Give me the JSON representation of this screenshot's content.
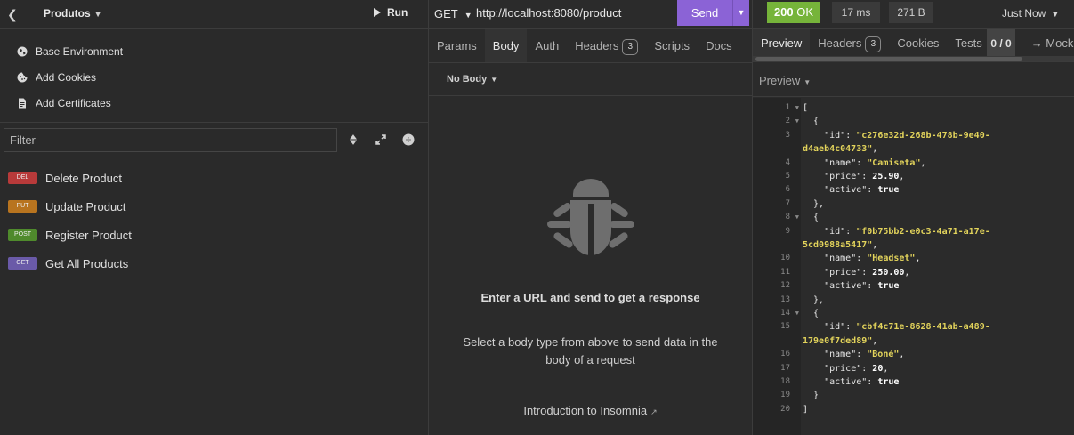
{
  "sidebar": {
    "title": "Produtos",
    "run_label": "Run",
    "links": [
      {
        "label": "Base Environment",
        "icon": "globe-icon"
      },
      {
        "label": "Add Cookies",
        "icon": "cookie-icon"
      },
      {
        "label": "Add Certificates",
        "icon": "certificate-icon"
      }
    ],
    "filter_placeholder": "Filter",
    "requests": [
      {
        "method": "DEL",
        "name": "Delete Product",
        "color": "#b83a3a"
      },
      {
        "method": "PUT",
        "name": "Update Product",
        "color": "#b8741f"
      },
      {
        "method": "POST",
        "name": "Register Product",
        "color": "#4f8a2c"
      },
      {
        "method": "GET",
        "name": "Get All Products",
        "color": "#6a5aa8"
      }
    ]
  },
  "request": {
    "method": "GET",
    "url": "http://localhost:8080/product",
    "send_label": "Send",
    "tabs": [
      {
        "label": "Params"
      },
      {
        "label": "Body"
      },
      {
        "label": "Auth"
      },
      {
        "label": "Headers",
        "count": "3"
      },
      {
        "label": "Scripts"
      },
      {
        "label": "Docs"
      }
    ],
    "active_tab": "Body",
    "body_type": "No Body",
    "empty_title": "Enter a URL and send to get a response",
    "empty_desc": "Select a body type from above to send data in the body of a request",
    "intro_link": "Introduction to Insomnia"
  },
  "response": {
    "status_code": "200",
    "status_text": "OK",
    "time": "17 ms",
    "size": "271 B",
    "when": "Just Now",
    "tabs": [
      {
        "label": "Preview"
      },
      {
        "label": "Headers",
        "count": "3"
      },
      {
        "label": "Cookies"
      },
      {
        "label": "Tests",
        "count": "0 / 0"
      },
      {
        "label": "→ Mock"
      }
    ],
    "preview_mode": "Preview",
    "lines": [
      {
        "n": "1",
        "fold": true,
        "text": "["
      },
      {
        "n": "2",
        "fold": true,
        "text": "  {"
      },
      {
        "n": "3",
        "fold": false,
        "key": "\"id\"",
        "val": "\"c276e32d-268b-478b-9e40-",
        "type": "s"
      },
      {
        "n": "",
        "fold": false,
        "cont": "d4aeb4c04733\"",
        "tail": ","
      },
      {
        "n": "4",
        "fold": false,
        "key": "\"name\"",
        "val": "\"Camiseta\"",
        "type": "s",
        "tail": ","
      },
      {
        "n": "5",
        "fold": false,
        "key": "\"price\"",
        "val": "25.90",
        "type": "v",
        "tail": ","
      },
      {
        "n": "6",
        "fold": false,
        "key": "\"active\"",
        "val": "true",
        "type": "v"
      },
      {
        "n": "7",
        "fold": false,
        "text": "  },"
      },
      {
        "n": "8",
        "fold": true,
        "text": "  {"
      },
      {
        "n": "9",
        "fold": false,
        "key": "\"id\"",
        "val": "\"f0b75bb2-e0c3-4a71-a17e-",
        "type": "s"
      },
      {
        "n": "",
        "fold": false,
        "cont": "5cd0988a5417\"",
        "tail": ","
      },
      {
        "n": "10",
        "fold": false,
        "key": "\"name\"",
        "val": "\"Headset\"",
        "type": "s",
        "tail": ","
      },
      {
        "n": "11",
        "fold": false,
        "key": "\"price\"",
        "val": "250.00",
        "type": "v",
        "tail": ","
      },
      {
        "n": "12",
        "fold": false,
        "key": "\"active\"",
        "val": "true",
        "type": "v"
      },
      {
        "n": "13",
        "fold": false,
        "text": "  },"
      },
      {
        "n": "14",
        "fold": true,
        "text": "  {"
      },
      {
        "n": "15",
        "fold": false,
        "key": "\"id\"",
        "val": "\"cbf4c71e-8628-41ab-a489-",
        "type": "s"
      },
      {
        "n": "",
        "fold": false,
        "cont": "179e0f7ded89\"",
        "tail": ","
      },
      {
        "n": "16",
        "fold": false,
        "key": "\"name\"",
        "val": "\"Boné\"",
        "type": "s",
        "tail": ","
      },
      {
        "n": "17",
        "fold": false,
        "key": "\"price\"",
        "val": "20",
        "type": "v",
        "tail": ","
      },
      {
        "n": "18",
        "fold": false,
        "key": "\"active\"",
        "val": "true",
        "type": "v"
      },
      {
        "n": "19",
        "fold": false,
        "text": "  }"
      },
      {
        "n": "20",
        "fold": false,
        "text": "]"
      }
    ]
  }
}
